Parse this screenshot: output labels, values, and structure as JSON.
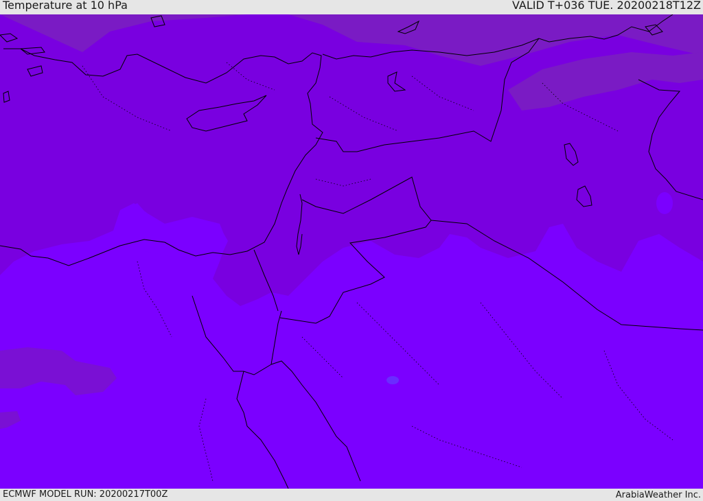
{
  "header": {
    "title": "Temperature at 10 hPa",
    "valid": "VALID T+036 TUE. 20200218T12Z"
  },
  "footer": {
    "model_run": "ECMWF MODEL RUN: 20200217T00Z",
    "credit": "ArabiaWeather Inc."
  },
  "map": {
    "colors": {
      "field_main": "#7b00ff",
      "field_band": "#7900e6",
      "field_cold": "#7a18c6",
      "coastline": "#000000"
    }
  }
}
